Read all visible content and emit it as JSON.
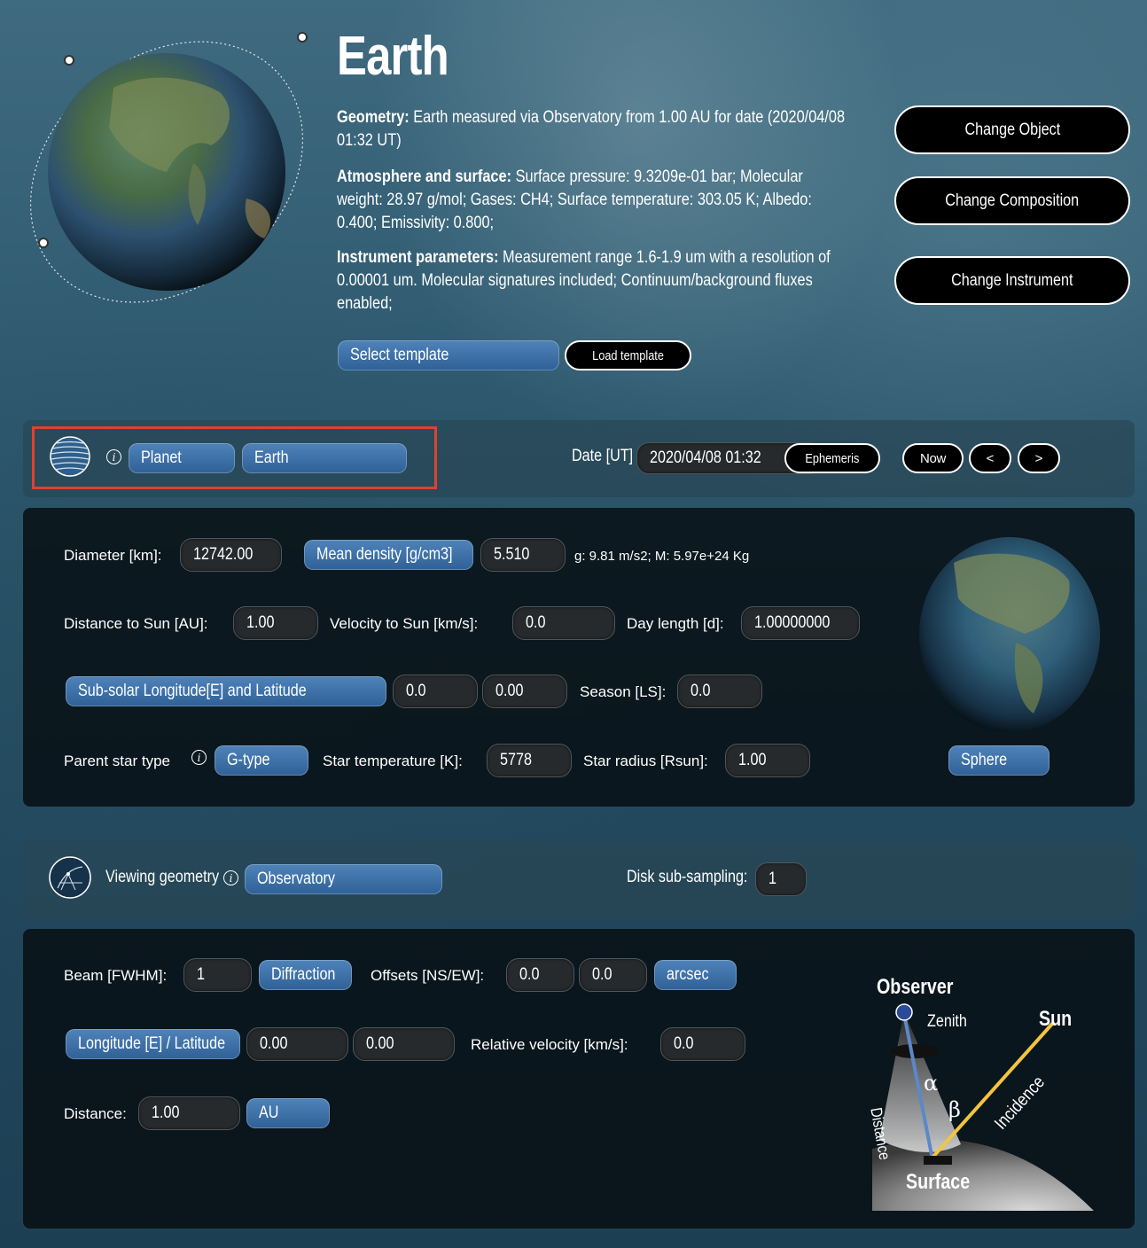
{
  "header": {
    "title": "Earth",
    "geometry_label": "Geometry:",
    "geometry_text": " Earth measured via Observatory from 1.00 AU for date (2020/04/08 01:32 UT)",
    "atmos_label": "Atmosphere and surface:",
    "atmos_text": " Surface pressure: 9.3209e-01 bar; Molecular weight: 28.97 g/mol; Gases: CH4; Surface temperature: 303.05 K; Albedo: 0.400; Emissivity: 0.800;",
    "instr_label": "Instrument parameters:",
    "instr_text": " Measurement range 1.6-1.9 um with a resolution of 0.00001 um. Molecular signatures included; Continuum/background fluxes enabled;",
    "buttons": {
      "change_object": "Change Object",
      "change_composition": "Change Composition",
      "change_instrument": "Change Instrument"
    },
    "select_template": "Select template",
    "load_template": "Load template"
  },
  "object_bar": {
    "type_value": "Planet",
    "object_value": "Earth",
    "date_label": "Date [UT]",
    "date_value": "2020/04/08 01:32",
    "ephemeris": "Ephemeris",
    "now": "Now",
    "prev": "<",
    "next": ">"
  },
  "object_params": {
    "diameter_label": "Diameter [km]:",
    "diameter_value": "12742.00",
    "density_btn": "Mean density [g/cm3]",
    "density_value": "5.510",
    "gravity_text": "g: 9.81 m/s2; M: 5.97e+24 Kg",
    "distance_label": "Distance to Sun [AU]:",
    "distance_value": "1.00",
    "velocity_label": "Velocity to Sun [km/s]:",
    "velocity_value": "0.0",
    "day_label": "Day length [d]:",
    "day_value": "1.00000000",
    "subsolar_btn": "Sub-solar Longitude[E] and Latitude",
    "subsolar_lon": "0.0",
    "subsolar_lat": "0.00",
    "season_label": "Season [LS]:",
    "season_value": "0.0",
    "star_type_label": "Parent star type",
    "star_type_value": "G-type",
    "star_temp_label": "Star temperature [K]:",
    "star_temp_value": "5778",
    "star_radius_label": "Star radius [Rsun]:",
    "star_radius_value": "1.00",
    "sphere_btn": "Sphere"
  },
  "geometry_bar": {
    "label": "Viewing geometry",
    "value": "Observatory",
    "subsampling_label": "Disk sub-sampling:",
    "subsampling_value": "1"
  },
  "geometry_params": {
    "beam_label": "Beam [FWHM]:",
    "beam_value": "1",
    "diffraction_btn": "Diffraction",
    "offsets_label": "Offsets [NS/EW]:",
    "offset_ns": "0.0",
    "offset_ew": "0.0",
    "offset_unit": "arcsec",
    "lonlat_btn": "Longitude [E] / Latitude",
    "lon_value": "0.00",
    "lat_value": "0.00",
    "relvel_label": "Relative velocity [km/s]:",
    "relvel_value": "0.0",
    "distance_label": "Distance:",
    "distance_value": "1.00",
    "distance_unit": "AU"
  },
  "diagram": {
    "observer": "Observer",
    "zenith": "Zenith",
    "sun": "Sun",
    "alpha": "α",
    "beta": "β",
    "distance": "Distance",
    "incidence": "Incidence",
    "surface": "Surface"
  },
  "colors": {
    "accent_blue": "#3a6ea5",
    "highlight_red": "#e0412f"
  }
}
